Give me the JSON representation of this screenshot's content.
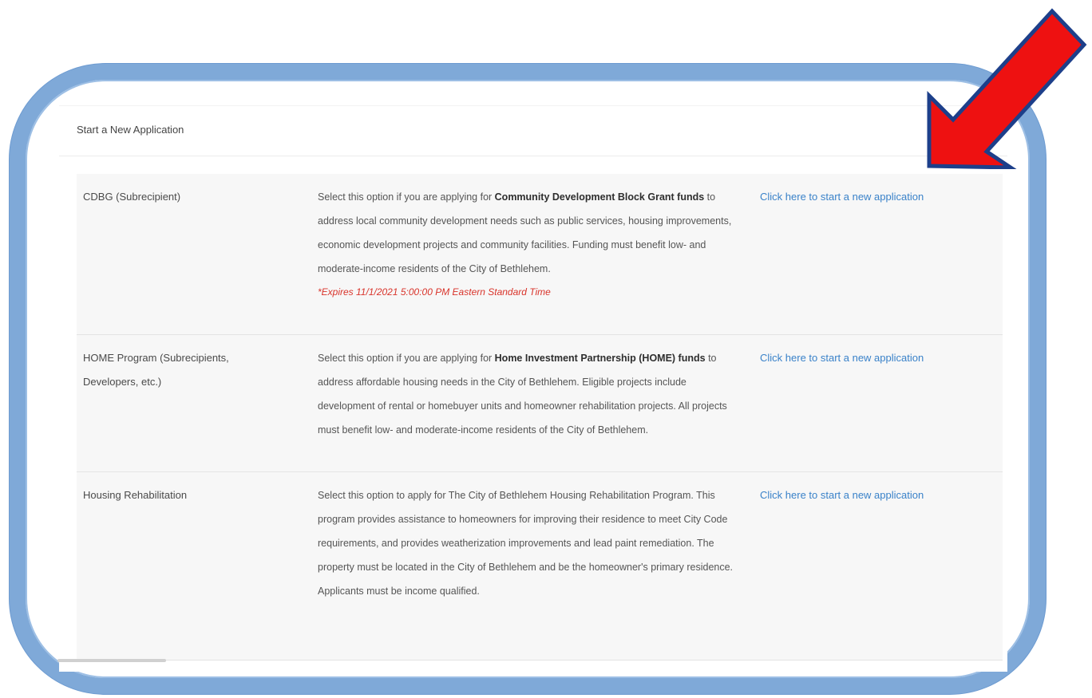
{
  "panel": {
    "title": "Start a New Application"
  },
  "rows": [
    {
      "name": "CDBG (Subrecipient)",
      "desc_pre": "Select this option if you are applying for ",
      "desc_bold": "Community Development Block Grant funds",
      "desc_post": " to address local community development needs such as public services, housing improvements, economic development projects and community facilities. Funding must benefit low- and moderate-income residents of the City of Bethlehem.",
      "expiry": "*Expires 11/1/2021 5:00:00 PM Eastern Standard Time",
      "link": "Click here to start a new application"
    },
    {
      "name": "HOME Program (Subrecipients, Developers, etc.)",
      "desc_pre": "Select this option if you are applying for ",
      "desc_bold": "Home Investment Partnership (HOME) funds",
      "desc_post": " to address affordable housing needs in the City of Bethlehem. Eligible projects include development of rental or homebuyer units and homeowner rehabilitation projects. All projects must benefit low- and moderate-income residents of the City of Bethlehem.",
      "link": "Click here to start a new application"
    },
    {
      "name": "Housing Rehabilitation",
      "desc_pre": "Select this option to apply for The City of Bethlehem Housing Rehabilitation Program. This program provides assistance to homeowners for improving their residence to meet City Code requirements, and provides weatherization improvements and lead paint remediation. The property must be located in the City of Bethlehem and be the homeowner's primary residence. Applicants must be income qualified.",
      "link": "Click here to start a new application"
    }
  ],
  "colors": {
    "frame": "#7fa9d8",
    "link": "#3a82c9",
    "expiry": "#d9342b",
    "arrow": "#ee1111"
  },
  "annotation": {
    "icon": "red-arrow-icon"
  }
}
